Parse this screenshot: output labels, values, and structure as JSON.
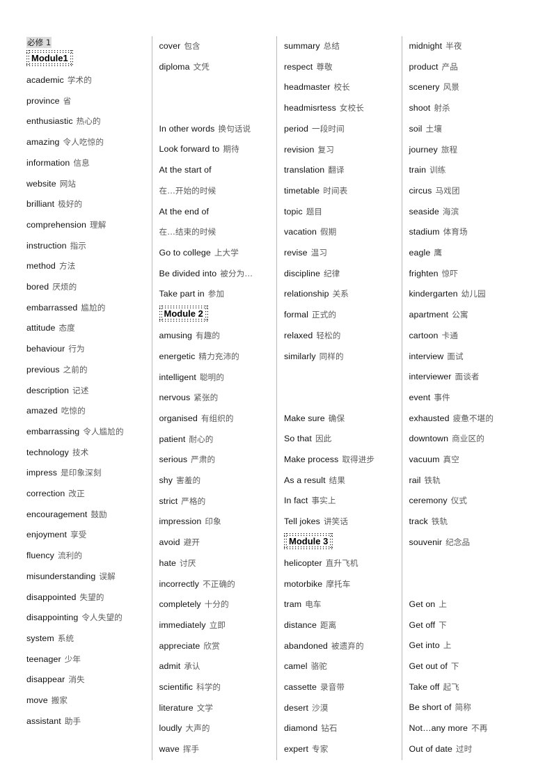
{
  "document": {
    "book_title": "必修 1",
    "type": "vocabulary-list",
    "language_pair": "English-Chinese",
    "column_count": 4
  },
  "columns": [
    {
      "id": "column-1",
      "blocks": [
        {
          "kind": "book-title",
          "text": "必修 1"
        },
        {
          "kind": "module-header",
          "text": "Module1"
        },
        {
          "kind": "entries",
          "items": [
            {
              "en": "academic",
              "zh": "学术的"
            },
            {
              "en": "province",
              "zh": "省"
            },
            {
              "en": "enthusiastic",
              "zh": "热心的"
            },
            {
              "en": "amazing",
              "zh": "令人吃惊的"
            },
            {
              "en": "information",
              "zh": "信息"
            },
            {
              "en": "website",
              "zh": "网站"
            },
            {
              "en": "brilliant",
              "zh": "极好的"
            },
            {
              "en": "comprehension",
              "zh": "理解"
            },
            {
              "en": "instruction",
              "zh": "指示"
            },
            {
              "en": "method",
              "zh": "方法"
            },
            {
              "en": "bored",
              "zh": "厌烦的"
            },
            {
              "en": "embarrassed",
              "zh": "尴尬的"
            },
            {
              "en": "attitude",
              "zh": "态度"
            },
            {
              "en": "behaviour",
              "zh": "行为"
            },
            {
              "en": "previous",
              "zh": "之前的"
            },
            {
              "en": "description",
              "zh": "记述"
            },
            {
              "en": "amazed",
              "zh": "吃惊的"
            },
            {
              "en": "embarrassing",
              "zh": "令人尴尬的"
            },
            {
              "en": "technology",
              "zh": "技术"
            },
            {
              "en": "impress",
              "zh": "是印象深刻"
            },
            {
              "en": "correction",
              "zh": "改正"
            },
            {
              "en": "encouragement",
              "zh": "鼓励"
            },
            {
              "en": "enjoyment",
              "zh": "享受"
            },
            {
              "en": "fluency",
              "zh": "流利的"
            },
            {
              "en": "misunderstanding",
              "zh": "误解"
            },
            {
              "en": "disappointed",
              "zh": "失望的"
            },
            {
              "en": "disappointing",
              "zh": "令人失望的"
            },
            {
              "en": "system",
              "zh": "系统"
            },
            {
              "en": "teenager",
              "zh": "少年"
            },
            {
              "en": "disappear",
              "zh": "消失"
            },
            {
              "en": "move",
              "zh": "搬家"
            },
            {
              "en": "assistant",
              "zh": "助手"
            }
          ]
        }
      ]
    },
    {
      "id": "column-2",
      "blocks": [
        {
          "kind": "entries",
          "items": [
            {
              "en": "cover",
              "zh": "包含"
            },
            {
              "en": "diploma",
              "zh": "文凭"
            }
          ]
        },
        {
          "kind": "spacer",
          "lines": 2
        },
        {
          "kind": "entries",
          "items": [
            {
              "en": "In other words",
              "zh": "换句话说"
            },
            {
              "en": "Look forward to",
              "zh": "期待"
            },
            {
              "en": "At the start of",
              "zh": ""
            },
            {
              "en": "",
              "zh": "在…开始的时候",
              "wrap": true
            },
            {
              "en": "At the end of",
              "zh": ""
            },
            {
              "en": "",
              "zh": "在…结束的时候",
              "wrap": true
            },
            {
              "en": "Go to college",
              "zh": "上大学"
            },
            {
              "en": "Be divided into",
              "zh": "被分为…"
            },
            {
              "en": "Take part in",
              "zh": "参加"
            }
          ]
        },
        {
          "kind": "module-header",
          "text": "Module 2"
        },
        {
          "kind": "entries",
          "items": [
            {
              "en": "amusing",
              "zh": "有趣的"
            },
            {
              "en": "energetic",
              "zh": "精力充沛的"
            },
            {
              "en": "intelligent",
              "zh": "聪明的"
            },
            {
              "en": "nervous",
              "zh": "紧张的"
            },
            {
              "en": "organised",
              "zh": "有组织的"
            },
            {
              "en": "patient",
              "zh": "耐心的"
            },
            {
              "en": "serious",
              "zh": "严肃的"
            },
            {
              "en": "shy",
              "zh": "害羞的"
            },
            {
              "en": "strict",
              "zh": "严格的"
            },
            {
              "en": "impression",
              "zh": "印象"
            },
            {
              "en": "avoid",
              "zh": "避开"
            },
            {
              "en": "hate",
              "zh": "讨厌"
            },
            {
              "en": "incorrectly",
              "zh": "不正确的"
            },
            {
              "en": "completely",
              "zh": "十分的"
            },
            {
              "en": "immediately",
              "zh": "立即"
            },
            {
              "en": "appreciate",
              "zh": "欣赏"
            },
            {
              "en": "admit",
              "zh": "承认"
            },
            {
              "en": "scientific",
              "zh": "科学的"
            },
            {
              "en": "literature",
              "zh": "文学"
            },
            {
              "en": "loudly",
              "zh": "大声的"
            },
            {
              "en": "wave",
              "zh": "挥手"
            }
          ]
        }
      ]
    },
    {
      "id": "column-3",
      "blocks": [
        {
          "kind": "entries",
          "items": [
            {
              "en": "summary",
              "zh": "总结"
            },
            {
              "en": "respect",
              "zh": "尊敬"
            },
            {
              "en": "headmaster",
              "zh": "校长"
            },
            {
              "en": "headmisrtess",
              "zh": "女校长"
            },
            {
              "en": "period",
              "zh": "一段时间"
            },
            {
              "en": "revision",
              "zh": "复习"
            },
            {
              "en": "translation",
              "zh": "翻译"
            },
            {
              "en": "timetable",
              "zh": "时间表"
            },
            {
              "en": "topic",
              "zh": "题目"
            },
            {
              "en": "vacation",
              "zh": "假期"
            },
            {
              "en": "revise",
              "zh": "温习"
            },
            {
              "en": "discipline",
              "zh": "纪律"
            },
            {
              "en": "relationship",
              "zh": "关系"
            },
            {
              "en": "formal",
              "zh": "正式的"
            },
            {
              "en": "relaxed",
              "zh": "轻松的"
            },
            {
              "en": "similarly",
              "zh": "同样的"
            }
          ]
        },
        {
          "kind": "spacer",
          "lines": 2
        },
        {
          "kind": "entries",
          "items": [
            {
              "en": "Make sure",
              "zh": "确保"
            },
            {
              "en": "So that",
              "zh": "因此"
            },
            {
              "en": "Make process",
              "zh": "取得进步"
            },
            {
              "en": "As a result",
              "zh": "结果"
            },
            {
              "en": "In fact",
              "zh": "事实上"
            },
            {
              "en": "Tell jokes",
              "zh": "讲笑话"
            }
          ]
        },
        {
          "kind": "module-header",
          "text": "Module 3"
        },
        {
          "kind": "entries",
          "items": [
            {
              "en": "helicopter",
              "zh": "直升飞机"
            },
            {
              "en": "motorbike",
              "zh": "摩托车"
            },
            {
              "en": "tram",
              "zh": "电车"
            },
            {
              "en": "distance",
              "zh": "距离"
            },
            {
              "en": "abandoned",
              "zh": "被遗弃的"
            },
            {
              "en": "camel",
              "zh": "骆驼"
            },
            {
              "en": "cassette",
              "zh": "录音带"
            },
            {
              "en": "desert",
              "zh": "沙漠"
            },
            {
              "en": "diamond",
              "zh": "钻石"
            },
            {
              "en": "expert",
              "zh": "专家"
            }
          ]
        }
      ]
    },
    {
      "id": "column-4",
      "blocks": [
        {
          "kind": "entries",
          "items": [
            {
              "en": "midnight",
              "zh": "半夜"
            },
            {
              "en": "product",
              "zh": "产品"
            },
            {
              "en": "scenery",
              "zh": "风景"
            },
            {
              "en": "shoot",
              "zh": "射杀"
            },
            {
              "en": "soil",
              "zh": "土壤"
            },
            {
              "en": "journey",
              "zh": "旅程"
            },
            {
              "en": "train",
              "zh": "训练"
            },
            {
              "en": "circus",
              "zh": "马戏团"
            },
            {
              "en": "seaside",
              "zh": "海滨"
            },
            {
              "en": "stadium",
              "zh": "体育场"
            },
            {
              "en": "eagle",
              "zh": "鹰"
            },
            {
              "en": "frighten",
              "zh": "惊吓"
            },
            {
              "en": "kindergarten",
              "zh": "幼儿园"
            },
            {
              "en": "apartment",
              "zh": "公寓"
            },
            {
              "en": "cartoon",
              "zh": "卡通"
            },
            {
              "en": "interview",
              "zh": "面试"
            },
            {
              "en": "interviewer",
              "zh": "面谈者"
            },
            {
              "en": "event",
              "zh": "事件"
            },
            {
              "en": "exhausted",
              "zh": "疲惫不堪的"
            },
            {
              "en": "downtown",
              "zh": "商业区的"
            },
            {
              "en": "vacuum",
              "zh": "真空"
            },
            {
              "en": "rail",
              "zh": "铁轨"
            },
            {
              "en": "ceremony",
              "zh": "仪式"
            },
            {
              "en": "track",
              "zh": "铁轨"
            },
            {
              "en": "souvenir",
              "zh": "纪念品"
            }
          ]
        },
        {
          "kind": "spacer",
          "lines": 2
        },
        {
          "kind": "entries",
          "items": [
            {
              "en": "Get on",
              "zh": "上"
            },
            {
              "en": "Get off",
              "zh": "下"
            },
            {
              "en": "Get into",
              "zh": "上"
            },
            {
              "en": "Get out of",
              "zh": "下"
            },
            {
              "en": "Take off",
              "zh": "起飞"
            },
            {
              "en": "Be short of",
              "zh": "简称"
            },
            {
              "en": "Not…any more",
              "zh": "不再"
            },
            {
              "en": "Out of date",
              "zh": "过时"
            }
          ]
        }
      ]
    }
  ],
  "colors": {
    "english_text": "#111111",
    "chinese_text": "#5a5a5a",
    "highlight": "#dcdcdc",
    "divider": "#b9b9b9",
    "page_background": "#ffffff"
  }
}
